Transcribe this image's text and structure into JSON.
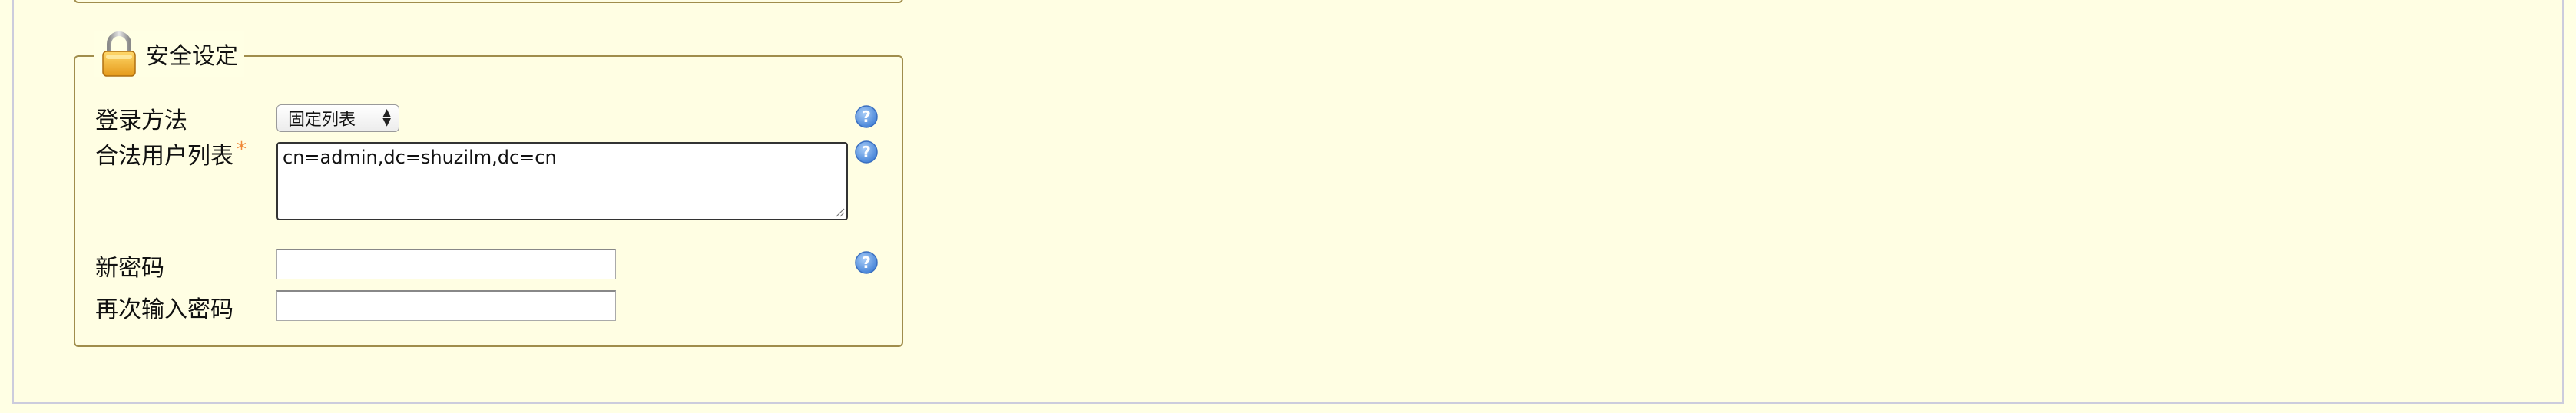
{
  "security_section": {
    "legend": "安全设定",
    "login_method": {
      "label": "登录方法",
      "selected": "固定列表"
    },
    "allowed_users": {
      "label": "合法用户列表",
      "required_mark": "*",
      "value": "cn=admin,dc=shuzilm,dc=cn"
    },
    "new_password": {
      "label": "新密码",
      "value": ""
    },
    "confirm_password": {
      "label": "再次输入密码",
      "value": ""
    }
  },
  "icons": {
    "lock": "lock-icon",
    "help": "help-icon"
  },
  "colors": {
    "background": "#ffffe4",
    "fieldset_border": "#a08d4c",
    "required": "#f08a3a",
    "help_icon": "#4a8ee0"
  }
}
